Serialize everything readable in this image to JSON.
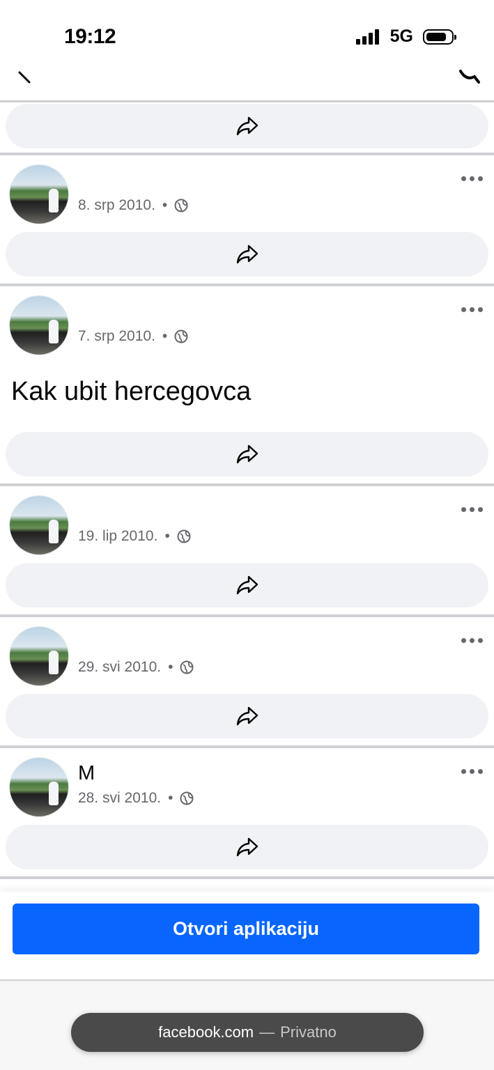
{
  "status_bar": {
    "time": "19:12",
    "network": "5G"
  },
  "posts": [
    {
      "date": "",
      "text": ""
    },
    {
      "date": "8. srp 2010.",
      "text": ""
    },
    {
      "date": "7. srp 2010.",
      "text": "Kak ubit hercegovca"
    },
    {
      "date": "19. lip 2010.",
      "text": ""
    },
    {
      "date": "29. svi 2010.",
      "text": ""
    },
    {
      "date": "28. svi 2010.",
      "text": ""
    }
  ],
  "author_visible_initial": "M",
  "meta_separator": "•",
  "cta": {
    "open_app_label": "Otvori aplikaciju"
  },
  "browser": {
    "domain": "facebook.com",
    "separator": "—",
    "mode": "Privatno"
  },
  "colors": {
    "accent": "#0866ff",
    "share_bar": "#f0f2f5",
    "meta_text": "#65676b"
  },
  "icons": [
    "back-icon",
    "search-icon",
    "share-icon",
    "more-icon",
    "globe-icon"
  ]
}
